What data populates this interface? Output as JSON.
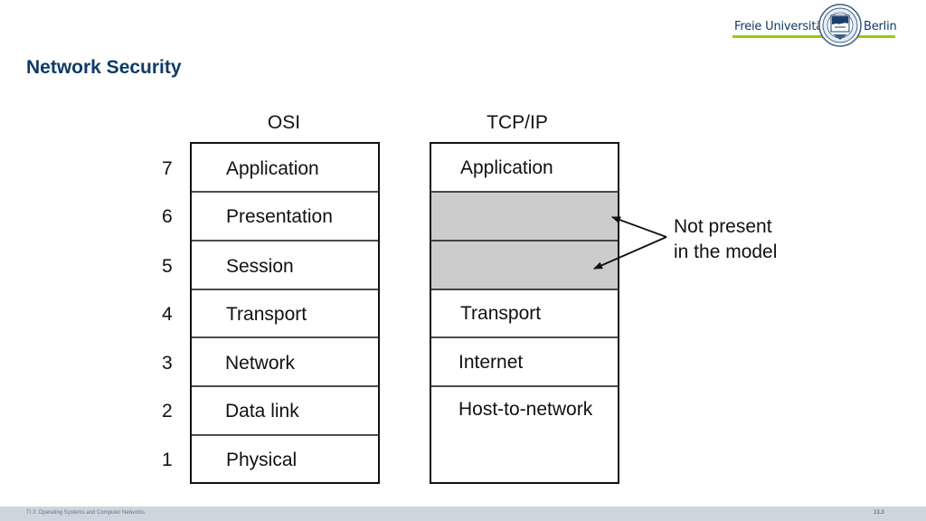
{
  "header": {
    "logo": {
      "text_left": "Freie Universität",
      "text_right": "Berlin",
      "accent_color": "#99cc00",
      "brand_color": "#0f3a66"
    },
    "title": "Network Security"
  },
  "diagram": {
    "osi": {
      "title": "OSI",
      "layers": [
        {
          "number": "7",
          "label": "Application"
        },
        {
          "number": "6",
          "label": "Presentation"
        },
        {
          "number": "5",
          "label": "Session"
        },
        {
          "number": "4",
          "label": "Transport"
        },
        {
          "number": "3",
          "label": "Network"
        },
        {
          "number": "2",
          "label": "Data link"
        },
        {
          "number": "1",
          "label": "Physical"
        }
      ]
    },
    "tcpip": {
      "title": "TCP/IP",
      "layers": [
        {
          "label": "Application",
          "present": true
        },
        {
          "label": "",
          "present": false
        },
        {
          "label": "",
          "present": false
        },
        {
          "label": "Transport",
          "present": true
        },
        {
          "label": "Internet",
          "present": true
        },
        {
          "label": "Host-to-network",
          "present": true
        }
      ],
      "absent_fill": "#cccccc"
    },
    "annotation": {
      "line1": "Not present",
      "line2": "in the model"
    }
  },
  "footer": {
    "course": "TI 3: Operating Systems and Computer Networks",
    "page": "13.3"
  }
}
